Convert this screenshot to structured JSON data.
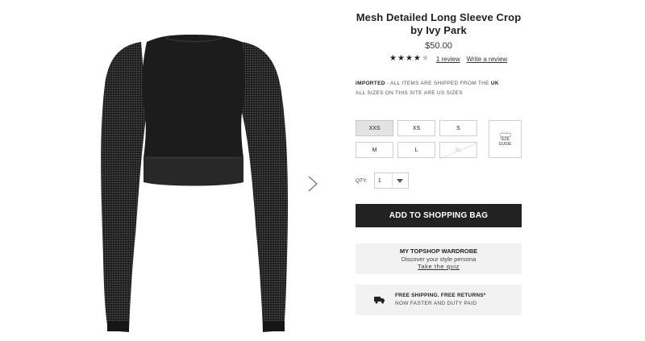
{
  "product": {
    "title": "Mesh Detailed Long Sleeve Crop by Ivy Park",
    "price": "$50.00",
    "rating": 4,
    "rating_max": 5,
    "review_count_label": "1 review",
    "write_review_label": "Write a review"
  },
  "shipping_info": {
    "imported_label": "IMPORTED",
    "imported_text": " - ALL ITEMS ARE SHIPPED FROM THE ",
    "country": "UK",
    "sizes_note": "ALL SIZES ON THIS SITE ARE US SIZES"
  },
  "sizes": {
    "options": [
      {
        "label": "XXS",
        "state": "selected"
      },
      {
        "label": "XS",
        "state": "available"
      },
      {
        "label": "S",
        "state": "available"
      },
      {
        "label": "M",
        "state": "available"
      },
      {
        "label": "L",
        "state": "available"
      },
      {
        "label": "XL",
        "state": "unavailable"
      }
    ],
    "guide_label": "SIZE GUIDE"
  },
  "quantity": {
    "label": "QTY:",
    "value": "1"
  },
  "actions": {
    "add_to_bag": "ADD TO SHOPPING BAG"
  },
  "wardrobe": {
    "title": "MY TOPSHOP WARDROBE",
    "subtitle": "Discover your style persona",
    "link": "Take the quiz"
  },
  "delivery": {
    "title": "FREE SHIPPING. FREE RETURNS*",
    "subtitle": "NOW FASTER AND DUTY PAID"
  },
  "icons": {
    "next": "chevron-right-icon",
    "qty_dropdown": "chevron-down-icon",
    "size_guide": "ruler-icon",
    "shipping": "truck-icon"
  },
  "colors": {
    "button_bg": "#222222",
    "panel_bg": "#f2f2f2",
    "garment": "#1c1c1c"
  }
}
